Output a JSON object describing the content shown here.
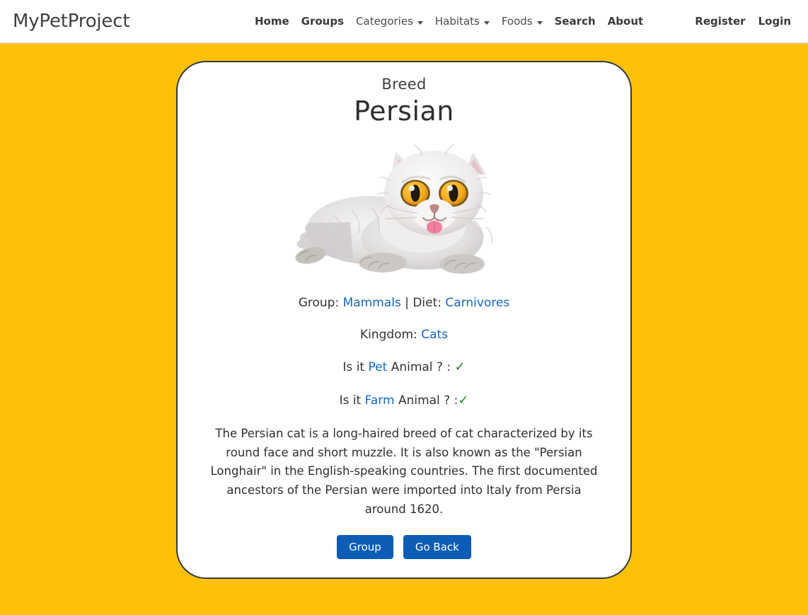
{
  "navbar": {
    "brand": "MyPetProject",
    "center_links": [
      {
        "label": "Home",
        "bold": true,
        "dropdown": false
      },
      {
        "label": "Groups",
        "bold": true,
        "dropdown": false
      },
      {
        "label": "Categories",
        "bold": false,
        "dropdown": true
      },
      {
        "label": "Habitats",
        "bold": false,
        "dropdown": true
      },
      {
        "label": "Foods",
        "bold": false,
        "dropdown": true
      },
      {
        "label": "Search",
        "bold": true,
        "dropdown": false
      },
      {
        "label": "About",
        "bold": true,
        "dropdown": false
      }
    ],
    "right_links": [
      {
        "label": "Register"
      },
      {
        "label": "Login"
      }
    ]
  },
  "card": {
    "subtitle": "Breed",
    "title": "Persian",
    "image_alt": "persian-cat-photo",
    "group_label": "Group:",
    "group_value": "Mammals",
    "separator": "|",
    "diet_label": "Diet:",
    "diet_value": "Carnivores",
    "kingdom_label": "Kingdom:",
    "kingdom_value": "Cats",
    "pet_prefix": "Is it",
    "pet_value": "Pet",
    "pet_suffix": "Animal ? :",
    "pet_check": "✓",
    "farm_prefix": "Is it",
    "farm_value": "Farm",
    "farm_suffix": "Animal ? :",
    "farm_check": "✓",
    "description": "The Persian cat is a long-haired breed of cat characterized by its round face and short muzzle. It is also known as the \"Persian Longhair\" in the English-speaking countries. The first documented ancestors of the Persian were imported into Italy from Persia around 1620.",
    "buttons": [
      {
        "label": "Group"
      },
      {
        "label": "Go Back"
      }
    ]
  },
  "colors": {
    "background": "#ffc107",
    "navbar_bg": "#ffffff",
    "card_border": "#343a40",
    "link": "#1266c4",
    "button": "#0d5cb6",
    "check": "#1a8a1a"
  }
}
